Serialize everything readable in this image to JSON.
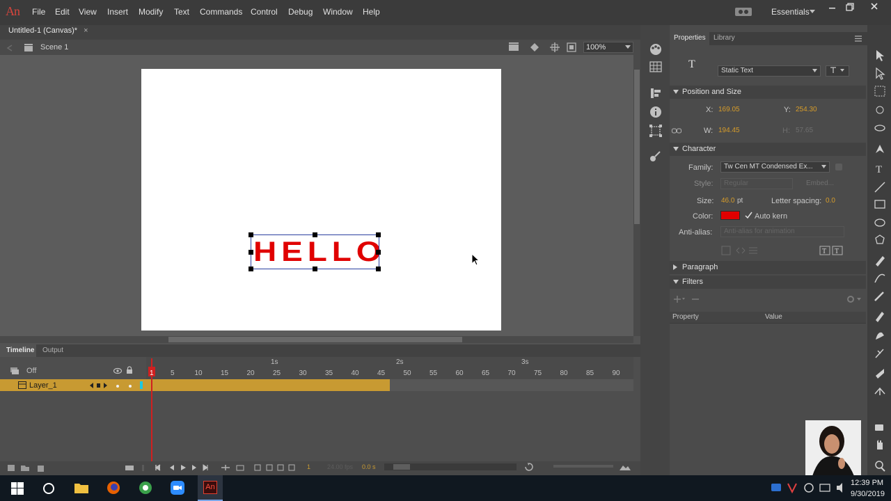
{
  "app": {
    "logo": "An"
  },
  "menu": [
    "File",
    "Edit",
    "View",
    "Insert",
    "Modify",
    "Text",
    "Commands",
    "Control",
    "Debug",
    "Window",
    "Help"
  ],
  "workspace": {
    "label": "Essentials"
  },
  "document": {
    "tab_title": "Untitled-1 (Canvas)*",
    "scene": "Scene 1",
    "zoom": "100%"
  },
  "stage": {
    "text": "HELLO",
    "text_color": "#e00000"
  },
  "timeline": {
    "tabs": [
      "Timeline",
      "Output"
    ],
    "onion_label": "Off",
    "layer_name": "Layer_1",
    "frame_numbers": [
      "1",
      "5",
      "10",
      "15",
      "20",
      "25",
      "30",
      "35",
      "40",
      "45",
      "50",
      "55",
      "60",
      "65",
      "70",
      "75",
      "80",
      "85",
      "90"
    ],
    "seconds": [
      "1s",
      "2s",
      "3s"
    ],
    "current_frame": "1",
    "fps": "24.00 fps",
    "time": "0.0 s"
  },
  "properties": {
    "tabs": [
      "Properties",
      "Library"
    ],
    "text_type": "Static Text",
    "position_size": {
      "title": "Position and Size",
      "x_label": "X:",
      "x": "169.05",
      "y_label": "Y:",
      "y": "254.30",
      "w_label": "W:",
      "w": "194.45",
      "h_label": "H:",
      "h": "57.65"
    },
    "character": {
      "title": "Character",
      "family_label": "Family:",
      "family": "Tw Cen MT Condensed Ex...",
      "style_label": "Style:",
      "style": "Regular",
      "embed": "Embed...",
      "size_label": "Size:",
      "size": "46.0",
      "size_unit": "pt",
      "spacing_label": "Letter spacing:",
      "spacing": "0.0",
      "color_label": "Color:",
      "color": "#e00000",
      "autokern_label": "Auto kern",
      "antialias_label": "Anti-alias:",
      "antialias": "Anti-alias for animation"
    },
    "paragraph_title": "Paragraph",
    "filters": {
      "title": "Filters",
      "col_property": "Property",
      "col_value": "Value"
    }
  },
  "taskbar": {
    "time": "12:39 PM",
    "date": "9/30/2019"
  }
}
